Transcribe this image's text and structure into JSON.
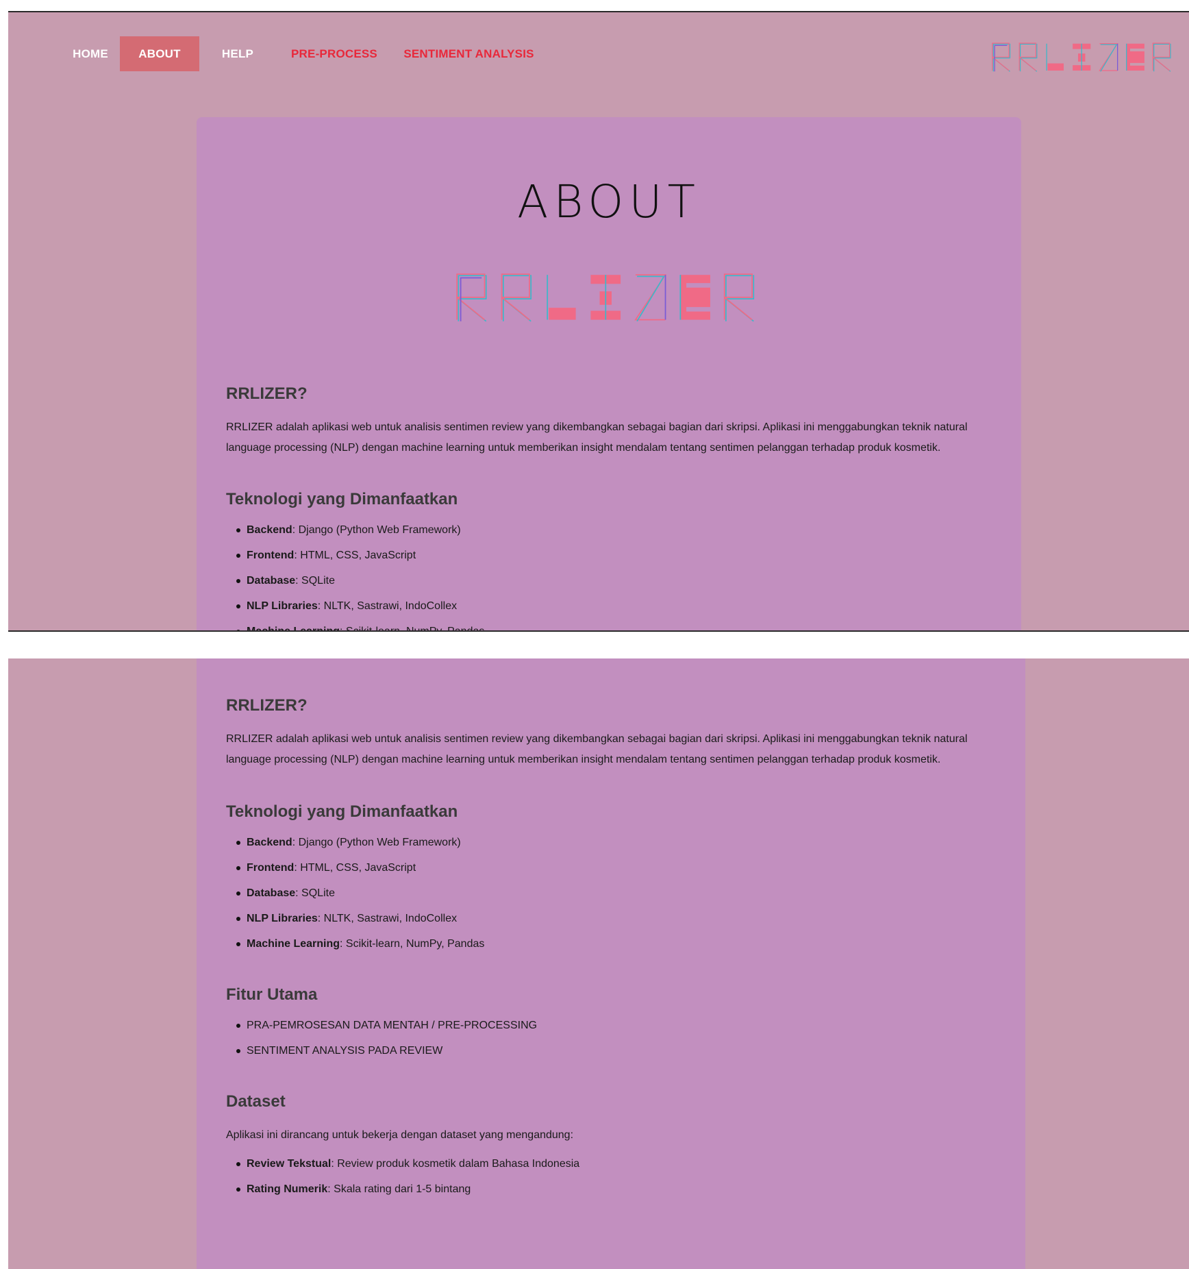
{
  "nav": {
    "home": "HOME",
    "about": "ABOUT",
    "help": "HELP",
    "preprocess": "PRE-PROCESS",
    "sentiment": "SENTIMENT ANALYSIS"
  },
  "logo_text": "RRLIZER",
  "about_title": "ABOUT",
  "sections": {
    "intro_heading": "RRLIZER?",
    "intro_line1": "RRLIZER adalah aplikasi web untuk analisis sentimen review yang dikembangkan sebagai bagian dari skripsi. Aplikasi ini menggabungkan teknik natural",
    "intro_line2": "language processing (NLP) dengan machine learning untuk memberikan insight mendalam tentang sentimen pelanggan terhadap produk kosmetik.",
    "tech_heading": "Teknologi yang Dimanfaatkan",
    "tech": [
      {
        "label": "Backend",
        "value": ": Django (Python Web Framework)"
      },
      {
        "label": "Frontend",
        "value": ": HTML, CSS, JavaScript"
      },
      {
        "label": "Database",
        "value": ": SQLite"
      },
      {
        "label": "NLP Libraries",
        "value": ": NLTK, Sastrawi, IndoCollex"
      },
      {
        "label": "Machine Learning",
        "value": ": Scikit-learn, NumPy, Pandas"
      }
    ],
    "features_heading": "Fitur Utama",
    "features": [
      "PRA-PEMROSESAN DATA MENTAH / PRE-PROCESSING",
      "SENTIMENT ANALYSIS PADA REVIEW"
    ],
    "dataset_heading": "Dataset",
    "dataset_intro": "Aplikasi ini dirancang untuk bekerja dengan dataset yang mengandung:",
    "dataset": [
      {
        "label": "Review Tekstual",
        "value": ": Review produk kosmetik dalam Bahasa Indonesia"
      },
      {
        "label": "Rating Numerik",
        "value": ": Skala rating dari 1-5 bintang"
      }
    ]
  },
  "colors": {
    "page_bg": "#c79caf",
    "card_bg": "#c28fbf",
    "nav_active": "#d46b73",
    "nav_red": "#e8283a",
    "logo_pink": "#f06a86",
    "logo_cyan": "#3fb6c9",
    "logo_purple": "#7a5bd6"
  }
}
